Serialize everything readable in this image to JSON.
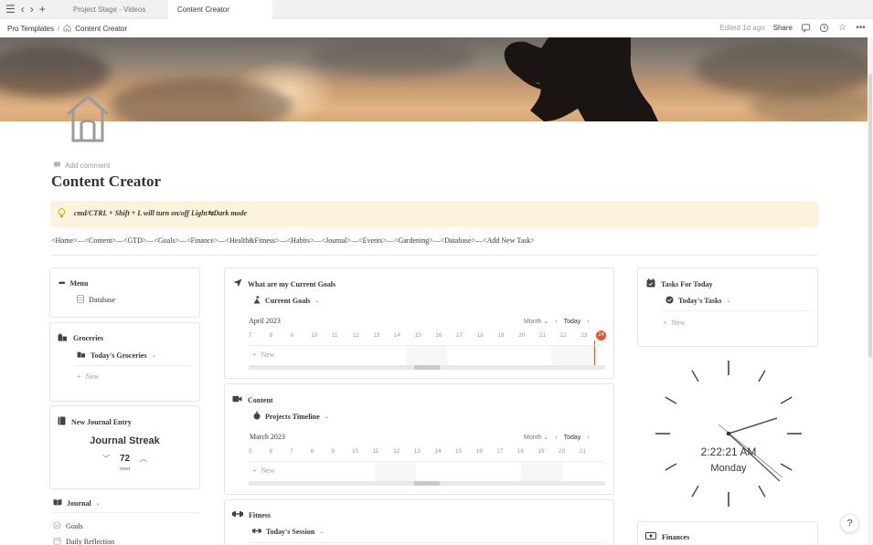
{
  "tabs": [
    {
      "label": "Project Stage - Videos",
      "active": false
    },
    {
      "label": "Content Creator",
      "active": true
    }
  ],
  "breadcrumb": {
    "parent": "Pro Templates",
    "sep": "/",
    "current": "Content Creator"
  },
  "topbar": {
    "edited": "Edited 1d ago",
    "share": "Share"
  },
  "page": {
    "add_comment": "Add comment",
    "title": "Content Creator",
    "callout": "cmd/CTRL + Shift + L will turn on/off Light⇆Dark mode",
    "nav": "<Home>—<Content>—<GTD>—<Goals>—<Finance>—<Health&Fitness>—<Habits>—<Journal>—<Events>—<Gardening>—<Database>—<Add New Task>"
  },
  "menu": {
    "title": "Menu",
    "item": "Database"
  },
  "groceries": {
    "title": "Groceries",
    "view": "Today's Groceries",
    "new": "New"
  },
  "journal_entry": {
    "title": "New Journal Entry",
    "streak_label": "Journal Streak",
    "streak_value": "72",
    "reset": "reset"
  },
  "journal": {
    "title": "Journal",
    "items": [
      "Goals",
      "Daily Reflection"
    ]
  },
  "goals_card": {
    "title": "What are my Current Goals",
    "view": "Current Goals",
    "month": "April 2023",
    "range": "Month",
    "today": "Today",
    "days": [
      "7",
      "8",
      "9",
      "10",
      "11",
      "12",
      "13",
      "14",
      "15",
      "16",
      "17",
      "18",
      "19",
      "20",
      "21",
      "22",
      "23"
    ],
    "today_badge": "24",
    "new": "New"
  },
  "content_card": {
    "title": "Content",
    "view": "Projects Timeline",
    "month": "March 2023",
    "range": "Month",
    "today": "Today",
    "days": [
      "5",
      "6",
      "7",
      "8",
      "9",
      "10",
      "11",
      "12",
      "13",
      "14",
      "15",
      "16",
      "17",
      "18",
      "19",
      "20",
      "21"
    ],
    "new": "New"
  },
  "fitness_card": {
    "title": "Fitness",
    "view": "Today's Session"
  },
  "tasks_card": {
    "title": "Tasks For Today",
    "view": "Today's Tasks",
    "new": "New"
  },
  "clock": {
    "time": "2:22:21 AM",
    "day": "Monday"
  },
  "finances": {
    "title": "Finances"
  },
  "help": "?"
}
